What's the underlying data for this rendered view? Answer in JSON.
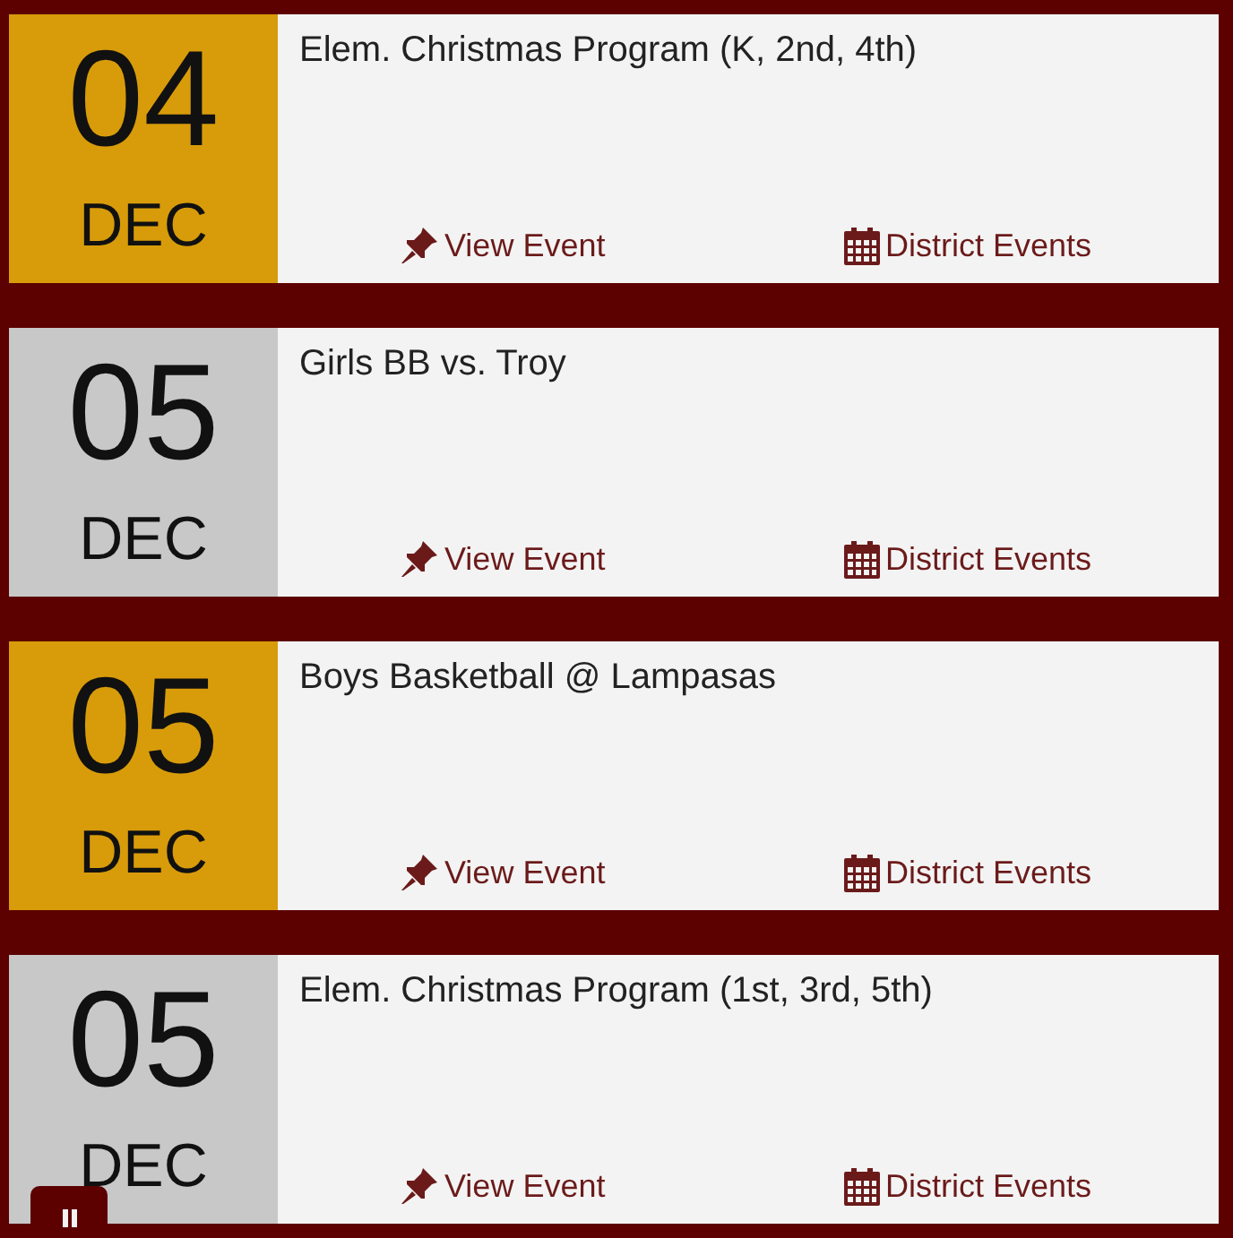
{
  "events": [
    {
      "day": "04",
      "month": "DEC",
      "color": "#d89c0a",
      "title": "Elem. Christmas Program (K, 2nd, 4th)",
      "links": [
        "View Event",
        "District Events"
      ]
    },
    {
      "day": "05",
      "month": "DEC",
      "color": "#c8c8c8",
      "title": "Girls BB vs. Troy",
      "links": [
        "View Event",
        "District Events"
      ]
    },
    {
      "day": "05",
      "month": "DEC",
      "color": "#d89c0a",
      "title": "Boys Basketball @ Lampasas",
      "links": [
        "View Event",
        "District Events"
      ]
    },
    {
      "day": "05",
      "month": "DEC",
      "color": "#c8c8c8",
      "title": "Elem. Christmas Program (1st, 3rd, 5th)",
      "links": [
        "View Event",
        "District Events"
      ]
    }
  ],
  "pause_control": {
    "kind": "pause"
  }
}
